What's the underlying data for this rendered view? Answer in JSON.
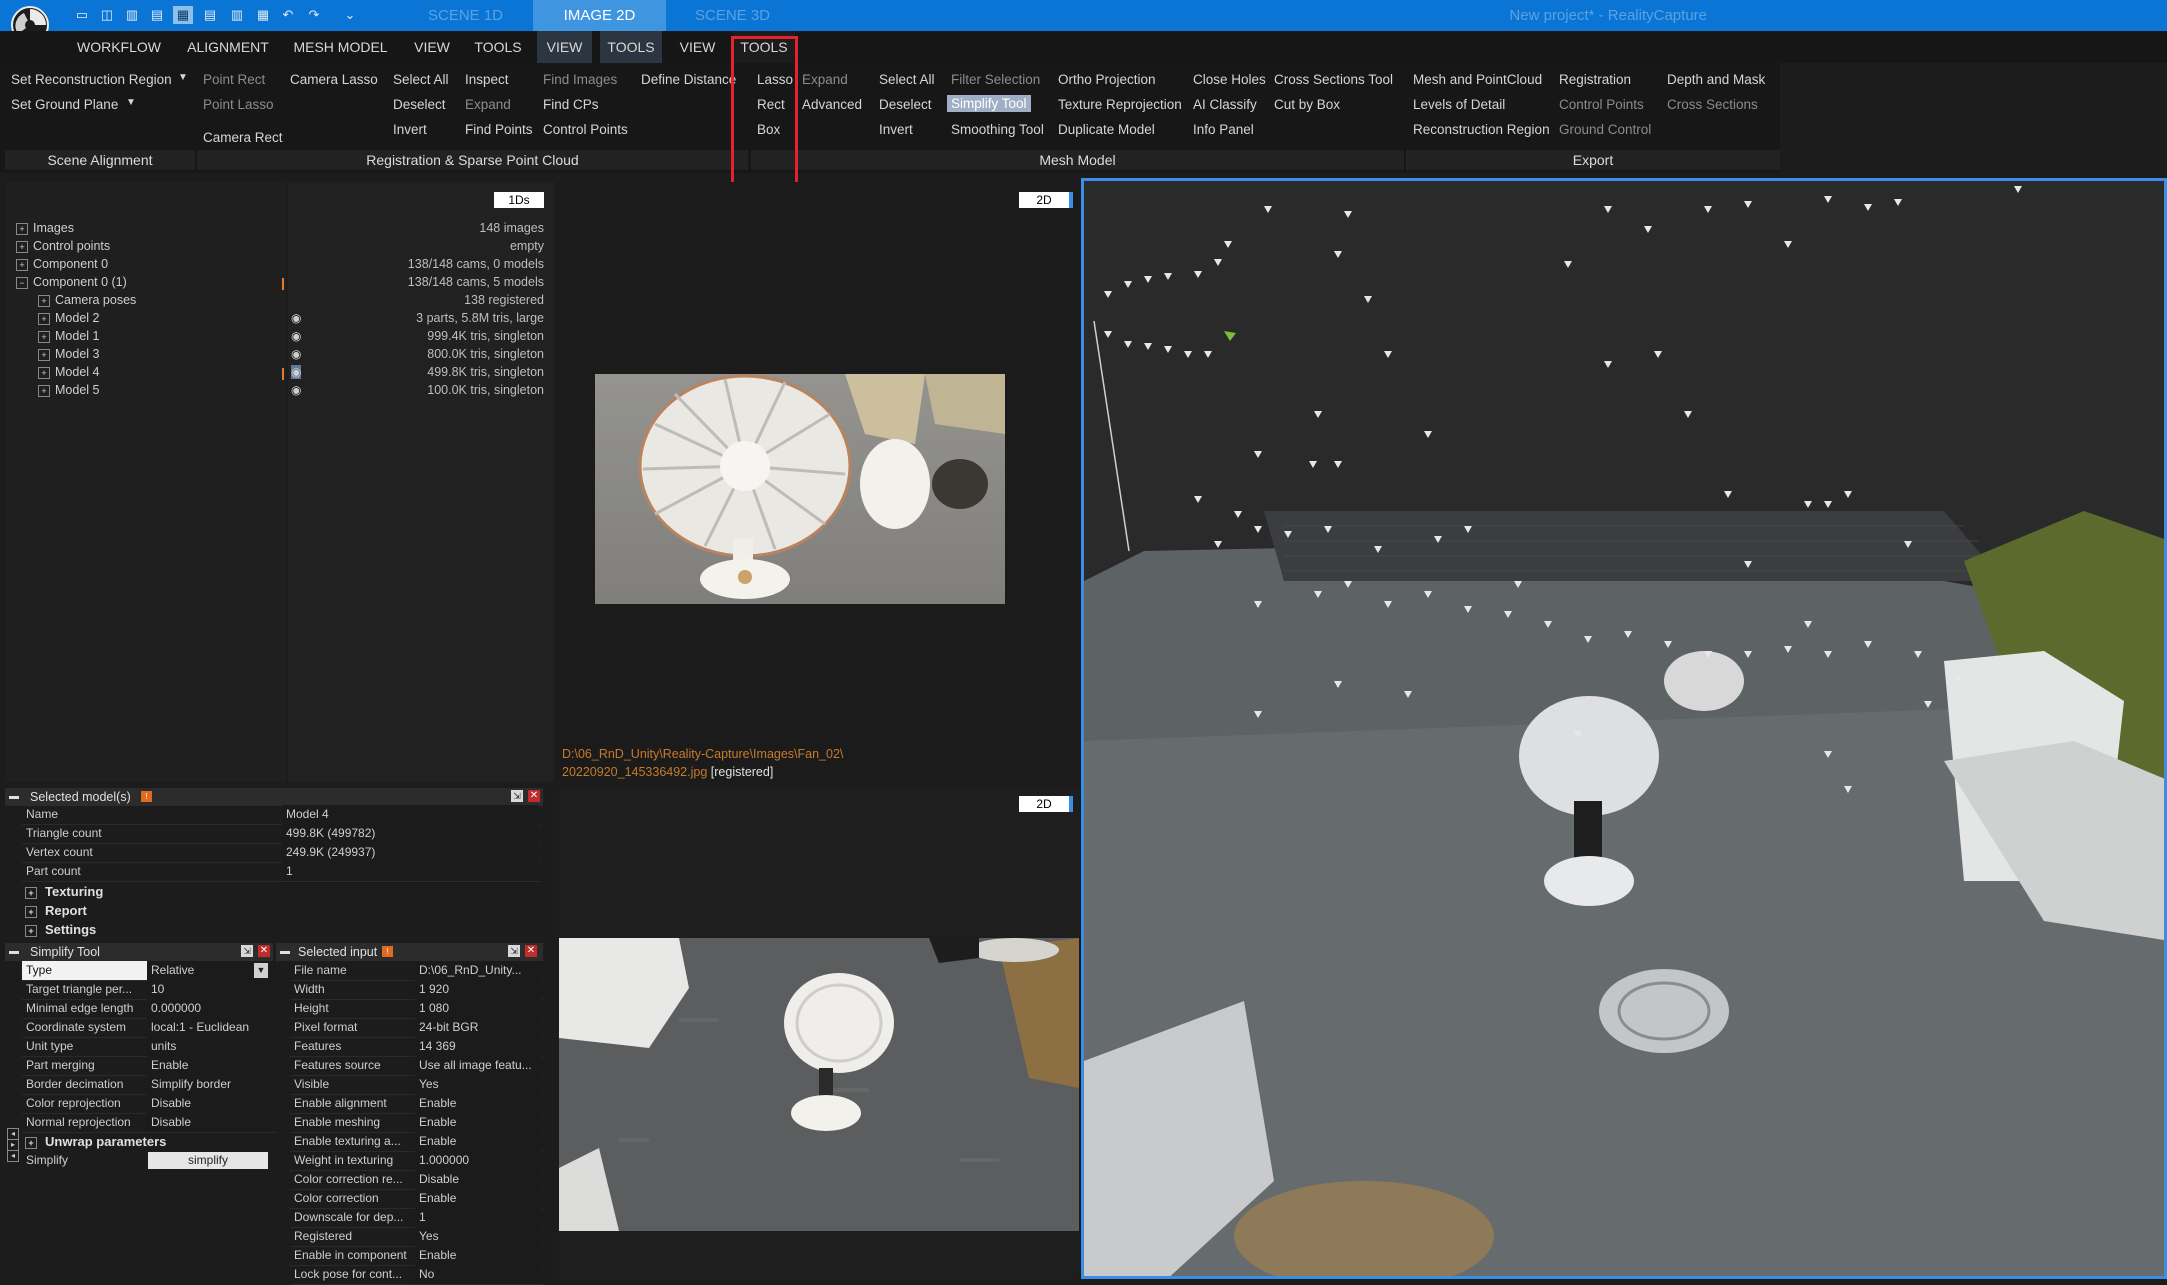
{
  "titlebar": {
    "tabs": [
      "SCENE 1D",
      "IMAGE 2D",
      "SCENE 3D"
    ],
    "app_title": "New project* - RealityCapture",
    "quick_icons": [
      "layout-1-icon",
      "layout-2-icon",
      "layout-3-icon",
      "layout-4-icon",
      "layout-5-icon",
      "layout-6-icon",
      "layout-7-icon",
      "layout-8-icon",
      "undo-icon",
      "redo-icon",
      "dropdown-icon"
    ]
  },
  "menubar": {
    "items": [
      "WORKFLOW",
      "ALIGNMENT",
      "MESH MODEL",
      "VIEW",
      "TOOLS",
      "VIEW",
      "TOOLS",
      "VIEW",
      "TOOLS"
    ]
  },
  "ribbon": {
    "set_reconstruction_region": "Set Reconstruction Region",
    "set_ground_plane": "Set Ground Plane",
    "point_rect": "Point Rect",
    "point_lasso": "Point Lasso",
    "camera_lasso": "Camera Lasso",
    "camera_rect": "Camera Rect",
    "select_all_1": "Select All",
    "deselect_1": "Deselect",
    "invert_1": "Invert",
    "inspect": "Inspect",
    "expand_1": "Expand",
    "find_points": "Find Points",
    "find_images": "Find Images",
    "find_cps": "Find CPs",
    "control_points_1": "Control Points",
    "define_distance": "Define Distance",
    "lasso": "Lasso",
    "rect": "Rect",
    "box": "Box",
    "expand_2": "Expand",
    "advanced": "Advanced",
    "select_all_2": "Select All",
    "deselect_2": "Deselect",
    "invert_2": "Invert",
    "filter_selection": "Filter Selection",
    "simplify_tool": "Simplify Tool",
    "smoothing_tool": "Smoothing Tool",
    "ortho_projection": "Ortho Projection",
    "texture_reprojection": "Texture Reprojection",
    "duplicate_model": "Duplicate Model",
    "close_holes": "Close Holes",
    "ai_classify": "AI Classify",
    "info_panel": "Info Panel",
    "cross_sections_tool": "Cross Sections Tool",
    "cut_by_box": "Cut by Box",
    "mesh_and_pointcloud": "Mesh and PointCloud",
    "levels_of_detail": "Levels of Detail",
    "reconstruction_region": "Reconstruction Region",
    "registration": "Registration",
    "control_points_2": "Control Points",
    "ground_control": "Ground Control",
    "depth_and_mask": "Depth and Mask",
    "cross_sections": "Cross Sections",
    "groups": [
      "Scene Alignment",
      "Registration & Sparse Point Cloud",
      "Mesh Model",
      "Export"
    ]
  },
  "tree": {
    "badge": "1Ds",
    "items": [
      {
        "label": "Images",
        "info": "148 images"
      },
      {
        "label": "Control points",
        "info": "empty"
      },
      {
        "label": "Component 0",
        "info": "138/148 cams, 0 models"
      },
      {
        "label": "Component 0 (1)",
        "info": "138/148 cams, 5 models"
      },
      {
        "label": "Camera poses",
        "info": "138 registered"
      },
      {
        "label": "Model 2",
        "info": "3 parts, 5.8M tris, large"
      },
      {
        "label": "Model 1",
        "info": "999.4K tris, singleton"
      },
      {
        "label": "Model 3",
        "info": "800.0K tris, singleton"
      },
      {
        "label": "Model 4",
        "info": "499.8K tris, singleton"
      },
      {
        "label": "Model 5",
        "info": "100.0K tris, singleton"
      }
    ]
  },
  "image_view_1": {
    "badge": "2D",
    "path": "D:\\06_RnD_Unity\\Reality-Capture\\Images\\Fan_02\\",
    "filename": "20220920_145336492.jpg",
    "status": "[registered]"
  },
  "image_view_2": {
    "badge": "2D"
  },
  "selected_models": {
    "title": "Selected model(s)",
    "rows": [
      {
        "k": "Name",
        "v": "Model 4"
      },
      {
        "k": "Triangle count",
        "v": "499.8K (499782)"
      },
      {
        "k": "Vertex count",
        "v": "249.9K (249937)"
      },
      {
        "k": "Part count",
        "v": "1"
      }
    ],
    "sections": [
      "Texturing",
      "Report",
      "Settings"
    ]
  },
  "simplify_tool": {
    "title": "Simplify Tool",
    "rows": [
      {
        "k": "Type",
        "v": "Relative"
      },
      {
        "k": "Target triangle per...",
        "v": "10"
      },
      {
        "k": "Minimal edge length",
        "v": "0.000000"
      },
      {
        "k": "Coordinate system",
        "v": "local:1 - Euclidean"
      },
      {
        "k": "Unit type",
        "v": "units"
      },
      {
        "k": "Part merging",
        "v": "Enable"
      },
      {
        "k": "Border decimation",
        "v": "Simplify border"
      },
      {
        "k": "Color reprojection",
        "v": "Disable"
      },
      {
        "k": "Normal reprojection",
        "v": "Disable"
      }
    ],
    "section": "Unwrap parameters",
    "simplify_label": "Simplify",
    "simplify_button": "simplify"
  },
  "selected_input": {
    "title": "Selected input",
    "rows": [
      {
        "k": "File name",
        "v": "D:\\06_RnD_Unity..."
      },
      {
        "k": "Width",
        "v": "1 920"
      },
      {
        "k": "Height",
        "v": "1 080"
      },
      {
        "k": "Pixel format",
        "v": "24-bit BGR"
      },
      {
        "k": "Features",
        "v": "14 369"
      },
      {
        "k": "Features source",
        "v": "Use all image featu..."
      },
      {
        "k": "Visible",
        "v": "Yes"
      },
      {
        "k": "Enable alignment",
        "v": "Enable"
      },
      {
        "k": "Enable meshing",
        "v": "Enable"
      },
      {
        "k": "Enable texturing a...",
        "v": "Enable"
      },
      {
        "k": "Weight in texturing",
        "v": "1.000000"
      },
      {
        "k": "Color correction re...",
        "v": "Disable"
      },
      {
        "k": "Color correction",
        "v": "Enable"
      },
      {
        "k": "Downscale for dep...",
        "v": "1"
      },
      {
        "k": "Registered",
        "v": "Yes"
      },
      {
        "k": "Enable in component",
        "v": "Enable"
      },
      {
        "k": "Lock pose for cont...",
        "v": "No"
      }
    ]
  },
  "colors": {
    "titlebar": "#0a75d4",
    "highlight": "#e0232e",
    "viewport_border": "#3a8ee6"
  }
}
